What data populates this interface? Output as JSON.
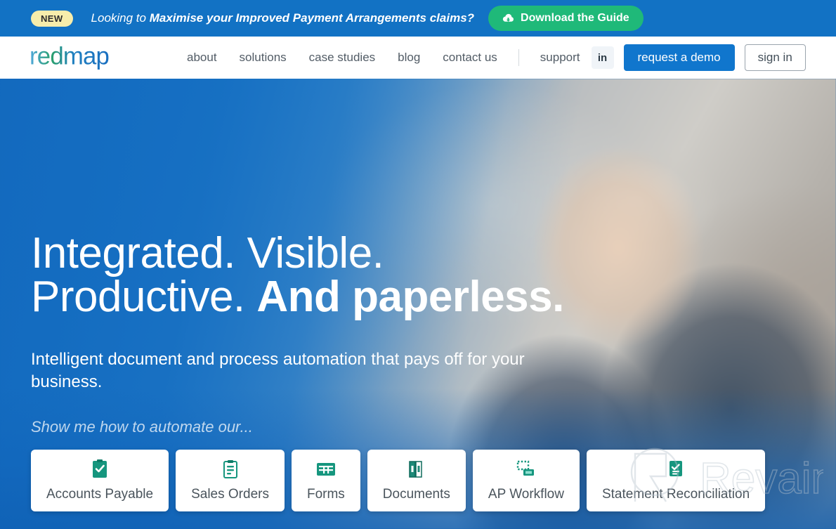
{
  "promo": {
    "badge": "NEW",
    "text_lead": "Looking to ",
    "text_bold": "Maximise your Improved Payment Arrangements claims?",
    "cta_label": "Download the Guide",
    "cta_icon": "cloud-download-icon",
    "bg_color": "#1272c4",
    "badge_color": "#f7edab",
    "cta_color": "#1fb979"
  },
  "nav": {
    "logo_text": "redmap",
    "links": [
      {
        "label": "about"
      },
      {
        "label": "solutions"
      },
      {
        "label": "case studies"
      },
      {
        "label": "blog"
      },
      {
        "label": "contact us"
      },
      {
        "label": "support"
      }
    ],
    "linkedin_label": "in",
    "demo_label": "request a demo",
    "signin_label": "sign in",
    "demo_color": "#1076cd"
  },
  "hero": {
    "headline_line1": "Integrated. Visible.",
    "headline_line2_light": "Productive. ",
    "headline_line2_bold": "And paperless.",
    "subhead": "Intelligent document and process automation that pays off for your business.",
    "prompt": "Show me how to automate our..."
  },
  "cards": [
    {
      "label": "Accounts Payable",
      "icon": "clipboard-check-icon"
    },
    {
      "label": "Sales Orders",
      "icon": "clipboard-lines-icon"
    },
    {
      "label": "Forms",
      "icon": "form-grid-icon"
    },
    {
      "label": "Documents",
      "icon": "binders-icon"
    },
    {
      "label": "AP Workflow",
      "icon": "workflow-icon"
    },
    {
      "label": "Statement Reconciliation",
      "icon": "statement-check-icon"
    }
  ],
  "watermark": {
    "text": "Revain"
  }
}
